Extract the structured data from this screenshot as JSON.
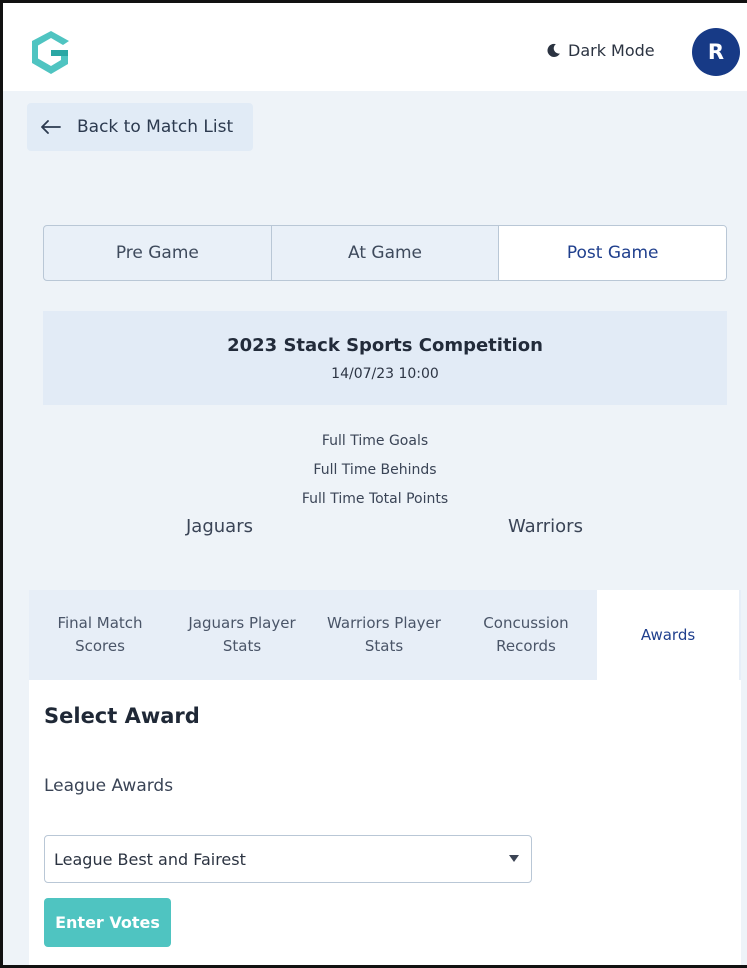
{
  "header": {
    "dark_mode_label": "Dark Mode",
    "avatar_initial": "R"
  },
  "nav": {
    "back_label": "Back to Match List"
  },
  "phase_tabs": [
    {
      "label": "Pre Game",
      "active": false
    },
    {
      "label": "At Game",
      "active": false
    },
    {
      "label": "Post Game",
      "active": true
    }
  ],
  "match": {
    "competition": "2023 Stack Sports Competition",
    "datetime": "14/07/23 10:00",
    "score_labels": [
      "Full Time Goals",
      "Full Time Behinds",
      "Full Time Total Points"
    ],
    "home_team": "Jaguars",
    "away_team": "Warriors"
  },
  "detail_tabs": [
    {
      "label": "Final Match Scores",
      "active": false
    },
    {
      "label": "Jaguars Player Stats",
      "active": false
    },
    {
      "label": "Warriors Player Stats",
      "active": false
    },
    {
      "label": "Concussion Records",
      "active": false
    },
    {
      "label": "Awards",
      "active": true
    }
  ],
  "awards": {
    "title": "Select Award",
    "section_label": "League Awards",
    "selected_award": "League Best and Fairest",
    "enter_button_label": "Enter Votes"
  },
  "colors": {
    "brand_teal": "#4fc4c1",
    "accent_navy": "#173a86",
    "active_tab_text": "#1f3f8d"
  },
  "icons": {
    "logo": "app-logo-icon",
    "moon": "moon-icon",
    "back": "arrow-left-icon",
    "dropdown": "chevron-down-icon"
  }
}
